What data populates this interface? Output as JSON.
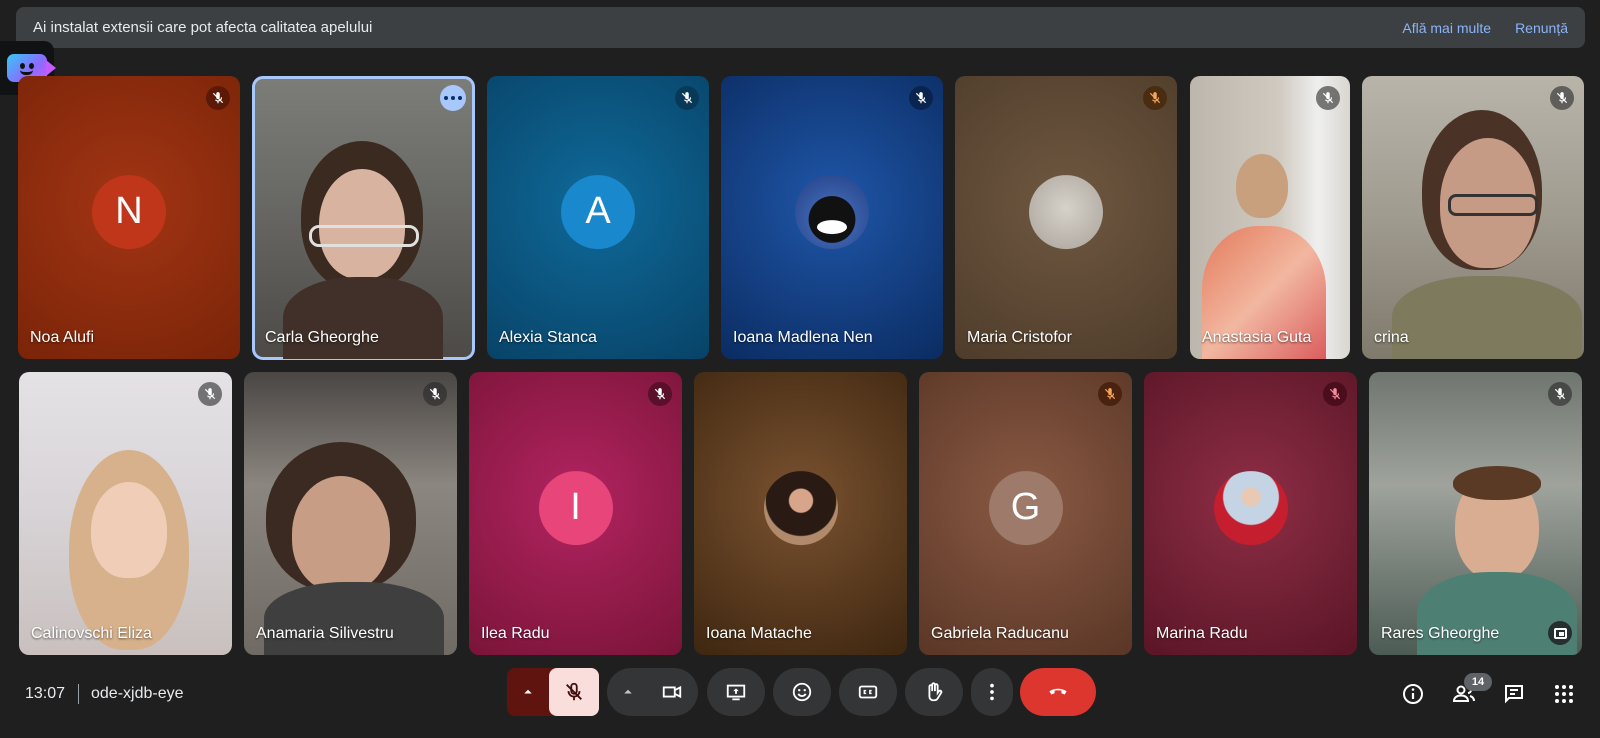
{
  "banner": {
    "message": "Ai instalat extensii care pot afecta calitatea apelului",
    "learn_more": "Află mai multe",
    "dismiss": "Renunță"
  },
  "participants": [
    {
      "name": "Noa Alufi",
      "initial": "N",
      "bg": "#8b2a0a",
      "avatar_color": "#c0361b",
      "muted": true
    },
    {
      "name": "Carla Gheorghe",
      "camera": true,
      "muted": false,
      "active": true
    },
    {
      "name": "Alexia Stanca",
      "initial": "A",
      "bg": "#0a4f7a",
      "avatar_color": "#1a88cc",
      "muted": true
    },
    {
      "name": "Ioana Madlena Nen",
      "bg": "#103a7a",
      "avatar_photo": "cat",
      "muted": true
    },
    {
      "name": "Maria Cristofor",
      "bg": "#5e4a36",
      "avatar_photo": "sketch",
      "muted": true
    },
    {
      "name": "Anastasia Guta",
      "camera": true,
      "muted": true
    },
    {
      "name": "crina",
      "camera": true,
      "muted": true
    },
    {
      "name": "Calinovschi Eliza",
      "camera": true,
      "muted": true
    },
    {
      "name": "Anamaria Silivestru",
      "camera": true,
      "muted": true
    },
    {
      "name": "Ilea Radu",
      "initial": "I",
      "bg": "#8c1b47",
      "avatar_color": "#e8457a",
      "muted": true
    },
    {
      "name": "Ioana Matache",
      "bg": "#5a3a1e",
      "avatar_photo": "portrait",
      "muted": false
    },
    {
      "name": "Gabriela Raducanu",
      "initial": "G",
      "bg": "#6e4634",
      "avatar_color": "#9d7a6a",
      "muted": true
    },
    {
      "name": "Marina Radu",
      "bg": "#6d1f33",
      "avatar_photo": "child",
      "muted": true
    },
    {
      "name": "Rares Gheorghe",
      "camera": true,
      "muted": true
    }
  ],
  "footer": {
    "time": "13:07",
    "meeting_code": "ode-xjdb-eye",
    "participant_count": "14"
  },
  "icons": {
    "mute": "mic-off-icon",
    "camera": "videocam-icon",
    "present": "present-screen-icon",
    "emoji": "emoji-icon",
    "captions": "closed-caption-icon",
    "hand": "raise-hand-icon",
    "more": "more-vert-icon",
    "end": "call-end-icon",
    "info": "info-icon",
    "people": "people-icon",
    "chat": "chat-icon",
    "activities": "apps-grid-icon"
  }
}
